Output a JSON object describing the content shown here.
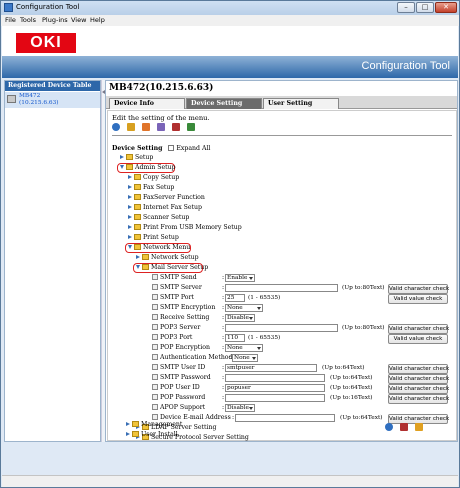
{
  "window": {
    "title": "Configuration Tool",
    "controls": [
      "–",
      "□",
      "✕"
    ]
  },
  "menu": [
    "File",
    "Tools",
    "Plug-ins",
    "View",
    "Help"
  ],
  "banner": {
    "logo": "OKI",
    "title": "Configuration Tool",
    "accent": "#2d67a9",
    "logo_color": "#e30613"
  },
  "left": {
    "header": "Registered Device Table",
    "device_name": "MB472",
    "device_ip": "(10.215.6.63)"
  },
  "right": {
    "device_title": "MB472(10.215.6.63)",
    "tabs": [
      "Device Info",
      "Device Setting",
      "User Setting"
    ],
    "edit_text": "Edit the setting of the menu.",
    "device_setting_label": "Device Setting",
    "expand_all": "Expand All"
  },
  "tree": {
    "setup": "Setup",
    "admin_setup": "Admin Setup",
    "copy_setup": "Copy Setup",
    "fax_setup": "Fax Setup",
    "faxserver": "FaxServer Function",
    "internet_fax": "Internet Fax Setup",
    "scanner_setup": "Scanner Setup",
    "print_usb": "Print From USB Memory Setup",
    "print_setup": "Print Setup",
    "network_menu": "Network Menu",
    "network_setup": "Network Setup",
    "mail_server_setup": "Mail Server Setup",
    "ldap": "LDAP Server Setting",
    "secure_protocol": "Secure Protocol Server Setting",
    "management": "Management",
    "user_install": "User Install"
  },
  "fields": {
    "smtp_send": {
      "label": "SMTP Send",
      "value": "Enable"
    },
    "smtp_server": {
      "label": "SMTP Server",
      "value": "",
      "hint": "(Up to:80Text)",
      "button": "Valid character check"
    },
    "smtp_port": {
      "label": "SMTP Port",
      "value": "25",
      "hint": "(1 - 65535)",
      "button": "Valid value check"
    },
    "smtp_encryption": {
      "label": "SMTP Encryption",
      "value": "None"
    },
    "receive_setting": {
      "label": "Receive Setting",
      "value": "Disable"
    },
    "pop3_server": {
      "label": "POP3 Server",
      "value": "",
      "hint": "(Up to:80Text)",
      "button": "Valid character check"
    },
    "pop3_port": {
      "label": "POP3 Port",
      "value": "110",
      "hint": "(1 - 65535)",
      "button": "Valid value check"
    },
    "pop_encryption": {
      "label": "POP Encryption",
      "value": "None"
    },
    "auth_method": {
      "label": "Authentication Method",
      "value": "None"
    },
    "smtp_user_id": {
      "label": "SMTP User ID",
      "value": "smtpuser",
      "hint": "(Up to:64Text)",
      "button": "Valid character check"
    },
    "smtp_password": {
      "label": "SMTP Password",
      "value": "",
      "hint": "(Up to:64Text)",
      "button": "Valid character check"
    },
    "pop_user_id": {
      "label": "POP User ID",
      "value": "popuser",
      "hint": "(Up to:64Text)",
      "button": "Valid character check"
    },
    "pop_password": {
      "label": "POP Password",
      "value": "",
      "hint": "(Up to:16Text)",
      "button": "Valid character check"
    },
    "apop_support": {
      "label": "APOP Support",
      "value": "Disable"
    },
    "device_email": {
      "label": "Device E-mail Address",
      "value": "",
      "hint": "(Up to:64Text)",
      "button": "Valid character check"
    }
  }
}
